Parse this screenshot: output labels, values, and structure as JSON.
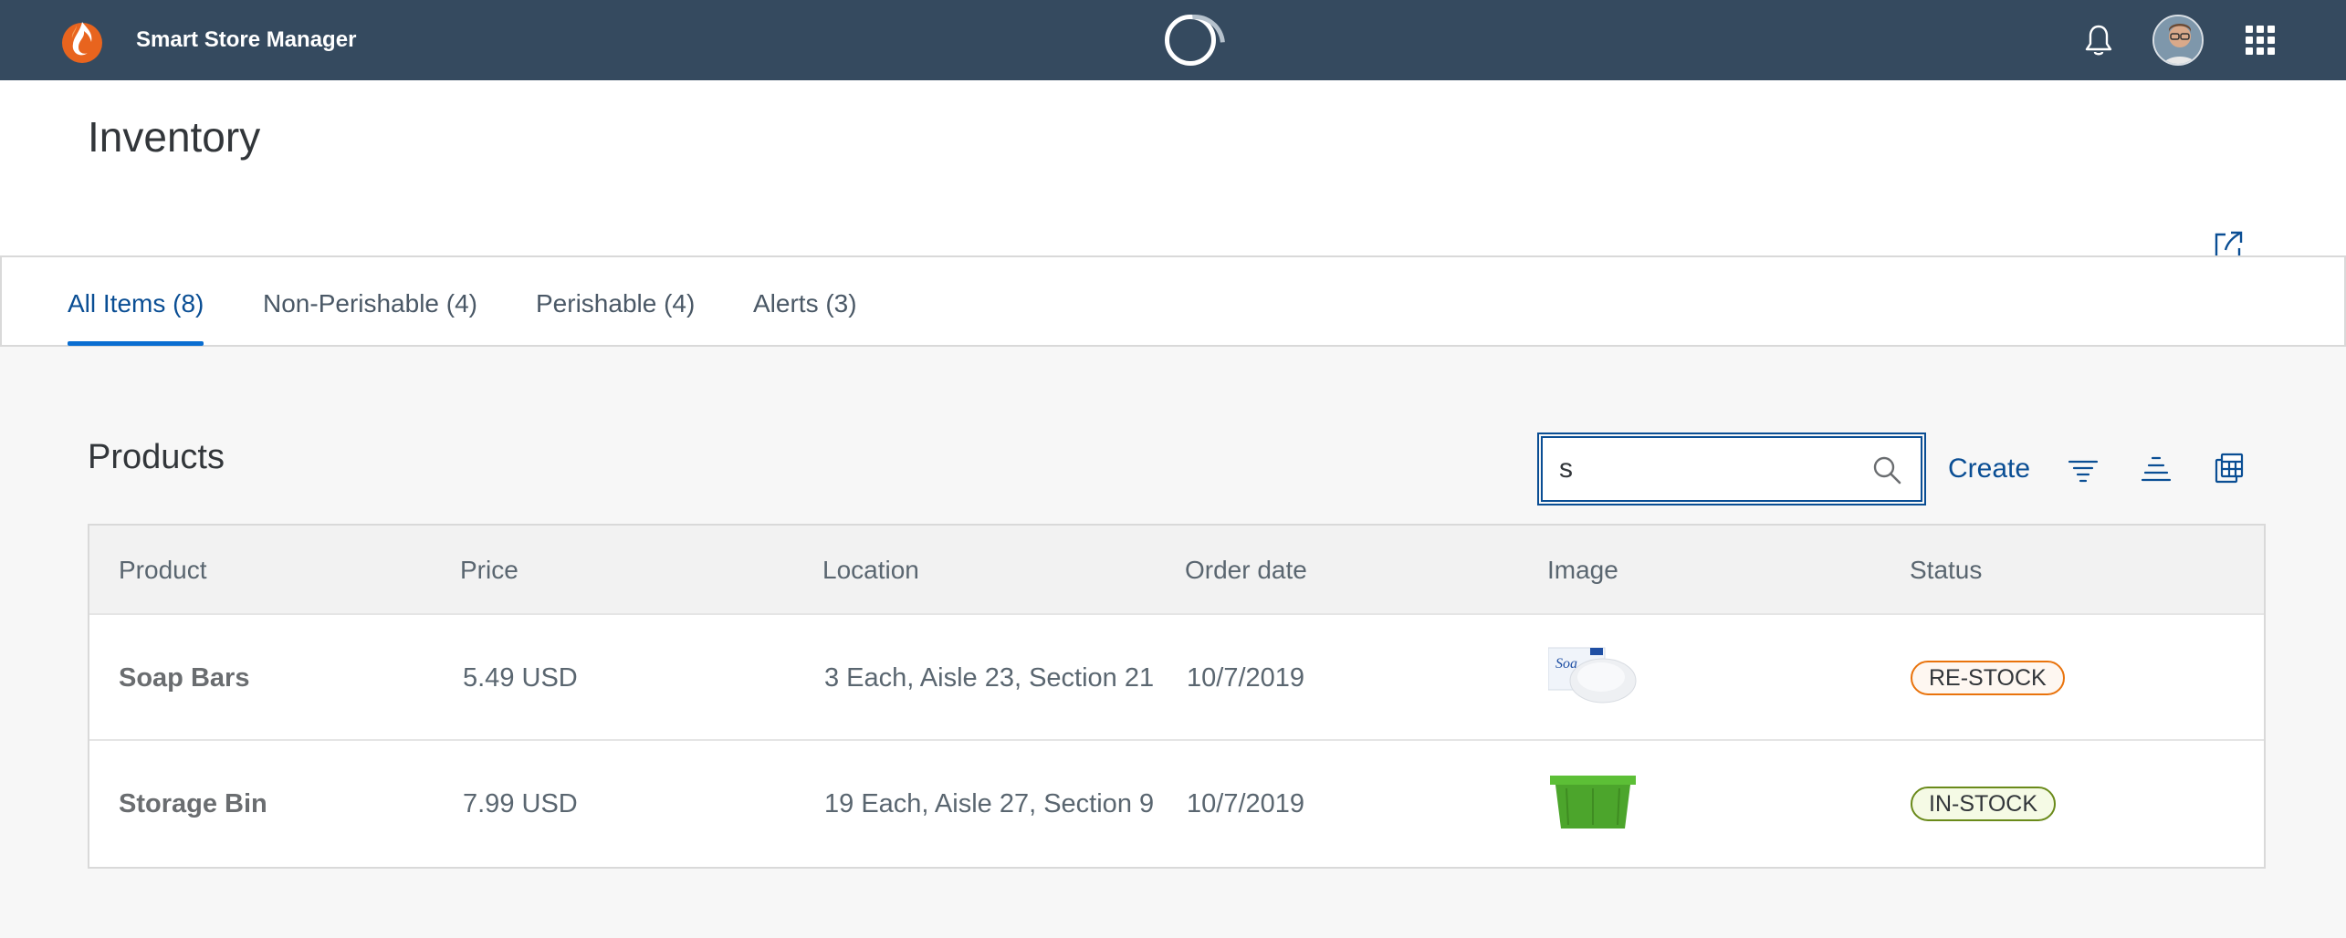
{
  "shell": {
    "app_title": "Smart Store Manager",
    "icons": [
      "logo-icon",
      "busy-indicator",
      "bell-icon",
      "avatar",
      "app-grid-icon"
    ]
  },
  "header": {
    "title": "Inventory",
    "share_icon": "share-icon"
  },
  "tabs": [
    {
      "label": "All Items (8)",
      "active": true
    },
    {
      "label": "Non-Perishable (4)",
      "active": false
    },
    {
      "label": "Perishable (4)",
      "active": false
    },
    {
      "label": "Alerts (3)",
      "active": false
    }
  ],
  "products": {
    "title": "Products",
    "search_value": "s",
    "create_label": "Create",
    "toolbar_icons": [
      "filter-icon",
      "group-icon",
      "table-settings-icon"
    ]
  },
  "table": {
    "columns": [
      "Product",
      "Price",
      "Location",
      "Order date",
      "Image",
      "Status"
    ],
    "rows": [
      {
        "product": "Soap Bars",
        "price": "5.49 USD",
        "location": "3 Each, Aisle 23, Section 21",
        "order_date": "10/7/2019",
        "image": "soap-bars-thumbnail",
        "status": "RE-STOCK"
      },
      {
        "product": "Storage Bin",
        "price": "7.99 USD",
        "location": "19 Each, Aisle 27, Section 9",
        "order_date": "10/7/2019",
        "image": "storage-bin-thumbnail",
        "status": "IN-STOCK"
      }
    ]
  },
  "colors": {
    "shell_bg": "#354a5f",
    "accent": "#0a4e94",
    "restock_border": "#e9730c",
    "instock_border": "#6a8a1a"
  }
}
